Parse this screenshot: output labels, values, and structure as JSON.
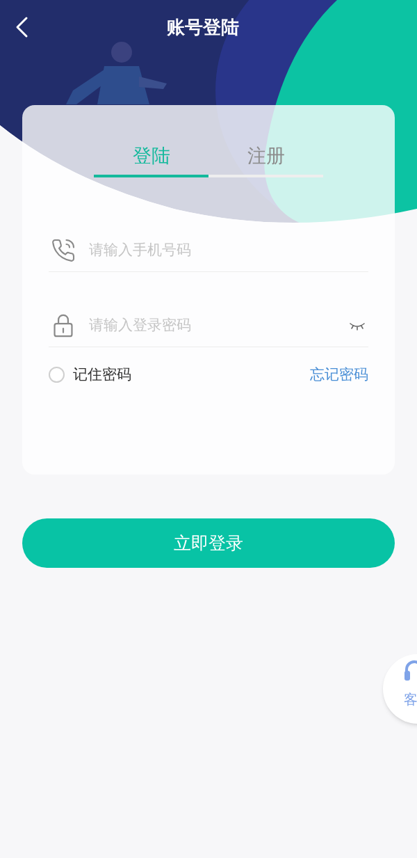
{
  "header": {
    "title": "账号登陆"
  },
  "tabs": [
    {
      "label": "登陆",
      "selected": true
    },
    {
      "label": "注册",
      "selected": false
    }
  ],
  "fields": [
    {
      "kind": "phone",
      "placeholder": "请输入手机号码"
    },
    {
      "kind": "password",
      "placeholder": "请输入登录密码"
    }
  ],
  "remember": {
    "label": "记住密码",
    "checked": false
  },
  "forgot_link": "忘记密码",
  "login_button": "立即登录",
  "support_button": {
    "label": "客"
  }
}
